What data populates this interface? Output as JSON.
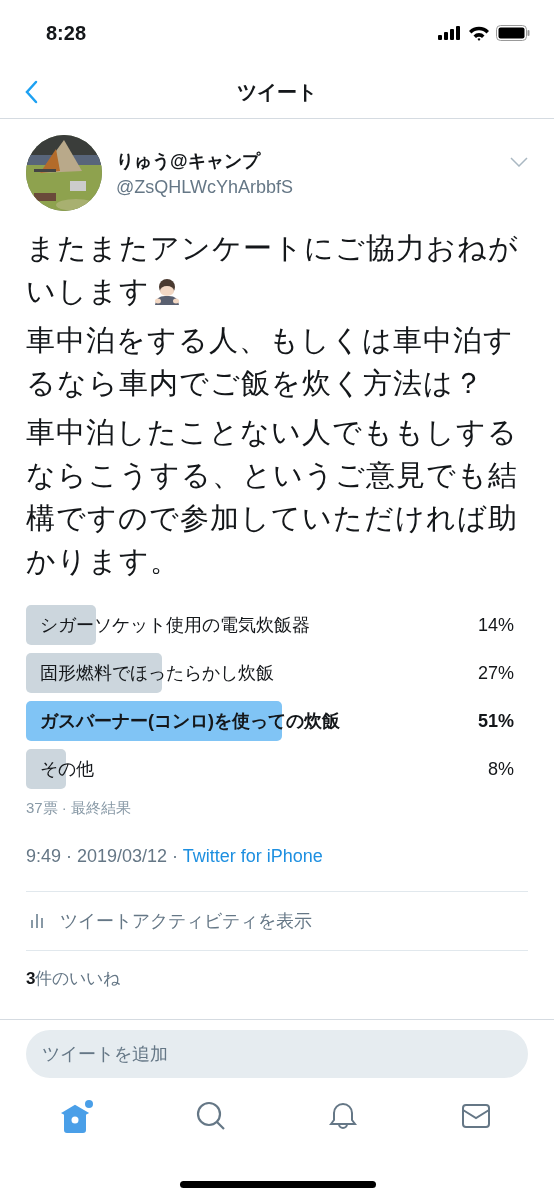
{
  "status_bar": {
    "time": "8:28"
  },
  "nav": {
    "title": "ツイート"
  },
  "author": {
    "name": "りゅう@キャンプ",
    "handle": "@ZsQHLWcYhArbbfS"
  },
  "tweet": {
    "paragraphs": [
      {
        "text": "またまたアンケートにご協力おねがいします",
        "has_emoji": true
      },
      {
        "text": "車中泊をする人、もしくは車中泊するなら車内でご飯を炊く方法は？"
      },
      {
        "text": "車中泊したことない人でももしするならこうする、というご意見でも結構ですので参加していただければ助かります。"
      }
    ]
  },
  "poll": {
    "options": [
      {
        "label": "シガーソケット使用の電気炊飯器",
        "percent": "14%",
        "winner": false
      },
      {
        "label": "固形燃料でほったらかし炊飯",
        "percent": "27%",
        "winner": false
      },
      {
        "label": "ガスバーナー(コンロ)を使っての炊飯",
        "percent": "51%",
        "winner": true
      },
      {
        "label": "その他",
        "percent": "8%",
        "winner": false
      }
    ],
    "summary": "37票 · 最終結果"
  },
  "meta": {
    "time": "9:49 · 2019/03/12 · ",
    "source": "Twitter for iPhone"
  },
  "activity": "ツイートアクティビティを表示",
  "likes": {
    "count": "3",
    "label": "件のいいね"
  },
  "compose": {
    "placeholder": "ツイートを追加"
  },
  "tabs": [
    {
      "kind": "home",
      "selected": true,
      "badge": true
    },
    {
      "kind": "search",
      "selected": false
    },
    {
      "kind": "notifications",
      "selected": false
    },
    {
      "kind": "messages",
      "selected": false
    }
  ]
}
